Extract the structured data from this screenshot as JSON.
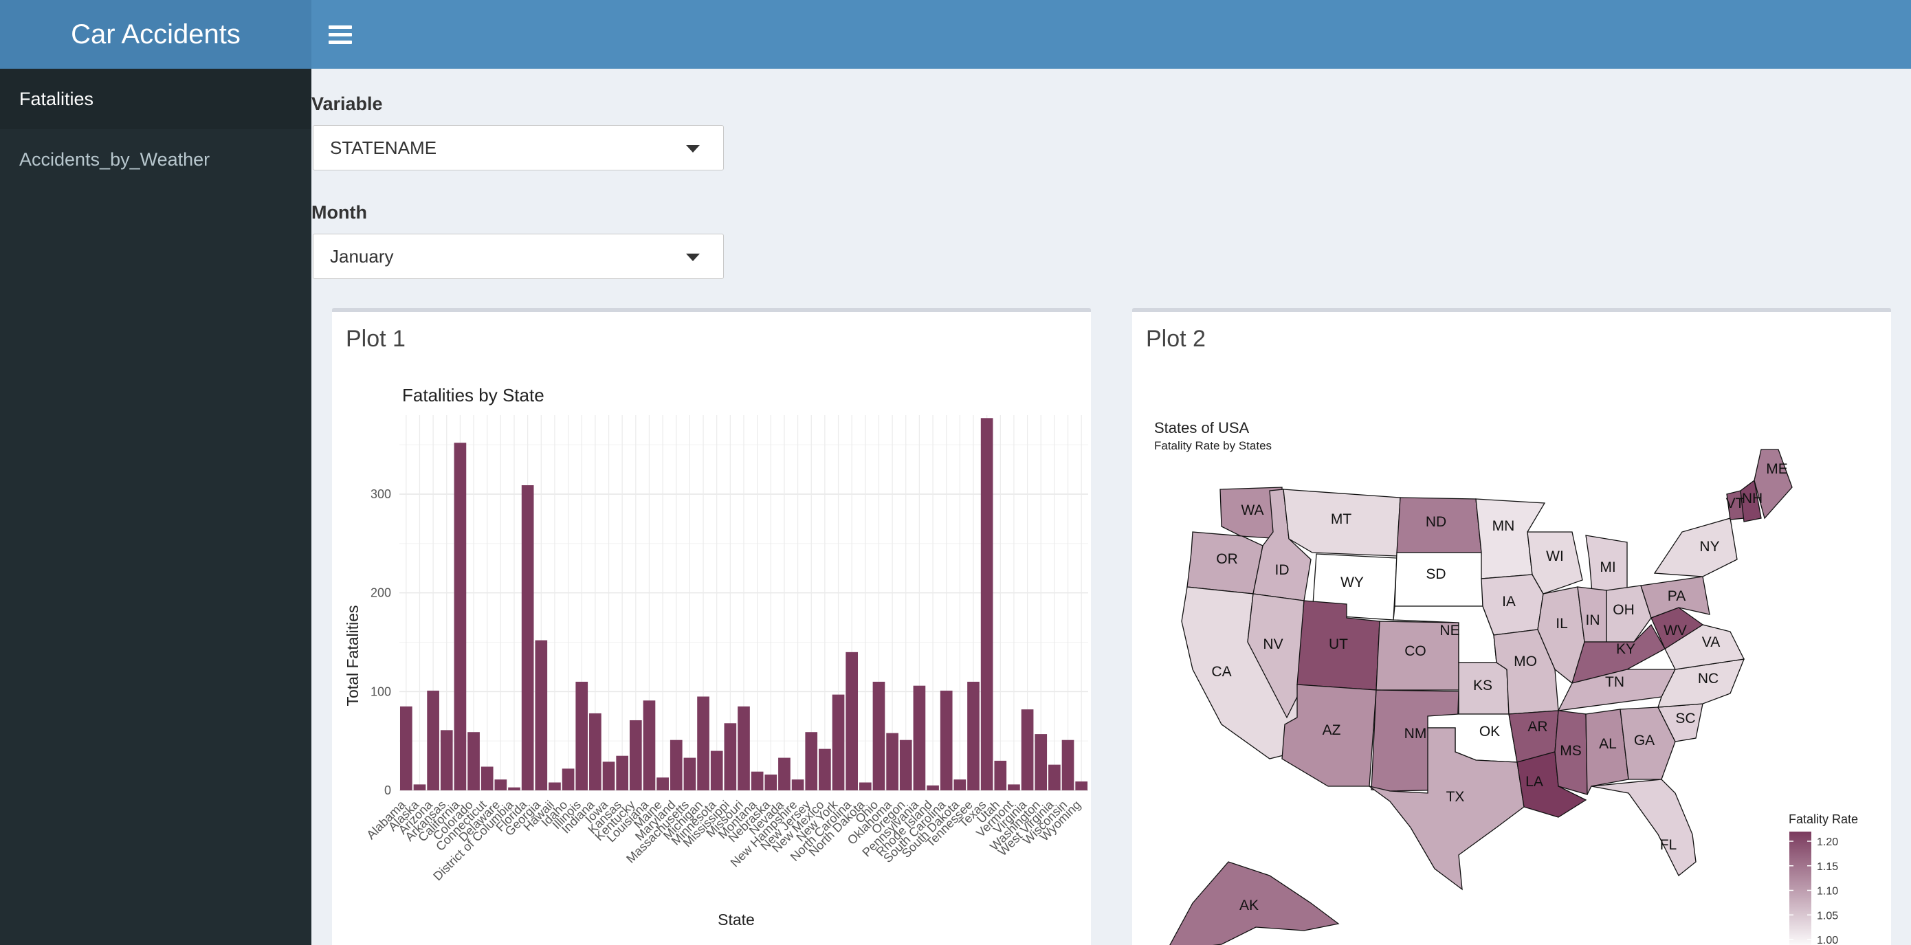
{
  "header": {
    "brand": "Car Accidents",
    "menu_icon": "hamburger-icon"
  },
  "sidebar": {
    "items": [
      {
        "label": "Fatalities",
        "active": true
      },
      {
        "label": "Accidents_by_Weather",
        "active": false
      }
    ]
  },
  "controls": {
    "variable": {
      "label": "Variable",
      "value": "STATENAME"
    },
    "month": {
      "label": "Month",
      "value": "January"
    }
  },
  "plot1": {
    "title": "Plot 1"
  },
  "plot2": {
    "title": "Plot 2"
  },
  "chart_data": [
    {
      "type": "bar",
      "title": "Fatalities by State",
      "xlabel": "State",
      "ylabel": "Total Fatalities",
      "ylim": [
        0,
        380
      ],
      "yticks": [
        0,
        100,
        200,
        300
      ],
      "bar_color": "#7b3b5e",
      "grid": true,
      "categories": [
        "Alabama",
        "Alaska",
        "Arizona",
        "Arkansas",
        "California",
        "Colorado",
        "Connecticut",
        "Delaware",
        "District of Columbia",
        "Florida",
        "Georgia",
        "Hawaii",
        "Idaho",
        "Illinois",
        "Indiana",
        "Iowa",
        "Kansas",
        "Kentucky",
        "Louisiana",
        "Maine",
        "Maryland",
        "Massachusetts",
        "Michigan",
        "Minnesota",
        "Mississippi",
        "Missouri",
        "Montana",
        "Nebraska",
        "Nevada",
        "New Hampshire",
        "New Jersey",
        "New Mexico",
        "New York",
        "North Carolina",
        "North Dakota",
        "Ohio",
        "Oklahoma",
        "Oregon",
        "Pennsylvania",
        "Rhode Island",
        "South Carolina",
        "South Dakota",
        "Tennessee",
        "Texas",
        "Utah",
        "Vermont",
        "Virginia",
        "Washington",
        "West Virginia",
        "Wisconsin",
        "Wyoming"
      ],
      "values": [
        85,
        6,
        101,
        61,
        352,
        59,
        24,
        11,
        3,
        309,
        152,
        8,
        22,
        110,
        78,
        29,
        35,
        71,
        91,
        13,
        51,
        33,
        95,
        40,
        68,
        85,
        19,
        16,
        33,
        11,
        59,
        42,
        97,
        140,
        8,
        110,
        58,
        51,
        106,
        5,
        101,
        11,
        110,
        377,
        30,
        6,
        82,
        57,
        26,
        51,
        9
      ]
    },
    {
      "type": "map",
      "title": "States of USA",
      "subtitle": "Fatality Rate by States",
      "legend": {
        "title": "Fatality Rate",
        "ticks": [
          "1.20",
          "1.15",
          "1.10",
          "1.05",
          "1.00"
        ],
        "placement": "right",
        "color_low": "#ffffff",
        "color_high": "#7b3b5e"
      },
      "states": [
        {
          "abbr": "WA",
          "rate": 1.12
        },
        {
          "abbr": "OR",
          "rate": 1.09
        },
        {
          "abbr": "CA",
          "rate": 1.04
        },
        {
          "abbr": "ID",
          "rate": 1.08
        },
        {
          "abbr": "NV",
          "rate": 1.07
        },
        {
          "abbr": "MT",
          "rate": 1.04
        },
        {
          "abbr": "WY",
          "rate": 1.0
        },
        {
          "abbr": "UT",
          "rate": 1.19
        },
        {
          "abbr": "CO",
          "rate": 1.1
        },
        {
          "abbr": "AZ",
          "rate": 1.12
        },
        {
          "abbr": "NM",
          "rate": 1.14
        },
        {
          "abbr": "ND",
          "rate": 1.14
        },
        {
          "abbr": "SD",
          "rate": 1.0
        },
        {
          "abbr": "NE",
          "rate": 1.0
        },
        {
          "abbr": "KS",
          "rate": 1.06
        },
        {
          "abbr": "OK",
          "rate": 1.0
        },
        {
          "abbr": "TX",
          "rate": 1.09
        },
        {
          "abbr": "MN",
          "rate": 1.03
        },
        {
          "abbr": "IA",
          "rate": 1.05
        },
        {
          "abbr": "MO",
          "rate": 1.07
        },
        {
          "abbr": "AR",
          "rate": 1.18
        },
        {
          "abbr": "LA",
          "rate": 1.21
        },
        {
          "abbr": "WI",
          "rate": 1.04
        },
        {
          "abbr": "IL",
          "rate": 1.07
        },
        {
          "abbr": "MS",
          "rate": 1.17
        },
        {
          "abbr": "MI",
          "rate": 1.05
        },
        {
          "abbr": "IN",
          "rate": 1.08
        },
        {
          "abbr": "OH",
          "rate": 1.06
        },
        {
          "abbr": "KY",
          "rate": 1.17
        },
        {
          "abbr": "TN",
          "rate": 1.08
        },
        {
          "abbr": "AL",
          "rate": 1.12
        },
        {
          "abbr": "GA",
          "rate": 1.09
        },
        {
          "abbr": "FL",
          "rate": 1.05
        },
        {
          "abbr": "SC",
          "rate": 1.05
        },
        {
          "abbr": "NC",
          "rate": 1.04
        },
        {
          "abbr": "VA",
          "rate": 1.04
        },
        {
          "abbr": "WV",
          "rate": 1.19
        },
        {
          "abbr": "PA",
          "rate": 1.1
        },
        {
          "abbr": "NY",
          "rate": 1.04
        },
        {
          "abbr": "VT",
          "rate": 1.18
        },
        {
          "abbr": "NH",
          "rate": 1.2
        },
        {
          "abbr": "ME",
          "rate": 1.14
        },
        {
          "abbr": "AK",
          "rate": 1.15
        }
      ]
    }
  ]
}
